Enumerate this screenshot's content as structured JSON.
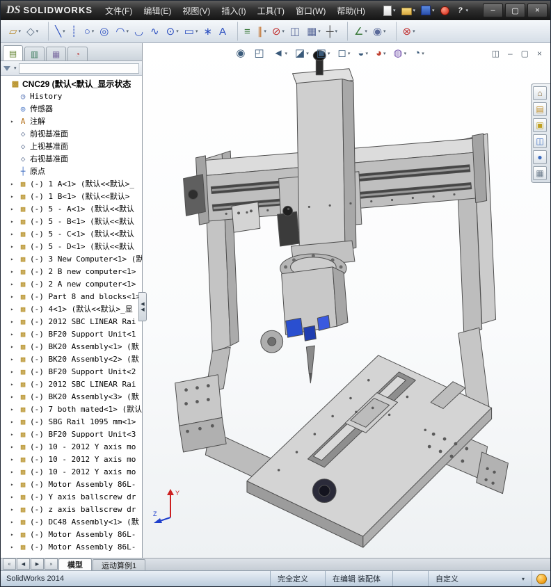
{
  "titlebar": {
    "logo": {
      "ds": "DS",
      "text": "SOLIDWORKS"
    },
    "menu": [
      "文件(F)",
      "编辑(E)",
      "视图(V)",
      "插入(I)",
      "工具(T)",
      "窗口(W)",
      "帮助(H)"
    ],
    "quick_icons": [
      {
        "name": "new-document-icon",
        "kind": "page",
        "glyph": "",
        "caret": "▾"
      },
      {
        "name": "open-icon",
        "kind": "folder",
        "glyph": "",
        "caret": "▾"
      },
      {
        "name": "save-icon",
        "kind": "floppy",
        "glyph": "",
        "caret": "▾"
      },
      {
        "name": "rebuild-icon",
        "kind": "rebuild",
        "glyph": "",
        "caret": ""
      },
      {
        "name": "help-icon",
        "kind": "help",
        "glyph": "?",
        "caret": "▾"
      }
    ],
    "window_buttons": [
      {
        "name": "minimize-button",
        "glyph": "–"
      },
      {
        "name": "restore-button",
        "glyph": "▢"
      },
      {
        "name": "close-button",
        "glyph": "×"
      }
    ]
  },
  "toolbar": {
    "icons": [
      {
        "name": "sketch-icon",
        "glyph": "▱",
        "color": "#b5872a",
        "caret": "▾",
        "gap": 0
      },
      {
        "name": "smart-dimension-icon",
        "glyph": "◇",
        "color": "#5f7186",
        "caret": "▾",
        "gap": 0
      },
      {
        "name": "line-icon",
        "glyph": "╲",
        "color": "#2b4fc0",
        "caret": "▾",
        "gap": 1
      },
      {
        "name": "centerline-icon",
        "glyph": "┊",
        "color": "#2b4fc0",
        "caret": "",
        "gap": 0
      },
      {
        "name": "circle-icon",
        "glyph": "○",
        "color": "#2b4fc0",
        "caret": "▾",
        "gap": 0
      },
      {
        "name": "perimeter-circle-icon",
        "glyph": "◎",
        "color": "#2b4fc0",
        "caret": "",
        "gap": 0
      },
      {
        "name": "centerpoint-arc-icon",
        "glyph": "◠",
        "color": "#2b4fc0",
        "caret": "▾",
        "gap": 0
      },
      {
        "name": "tangent-arc-icon",
        "glyph": "◡",
        "color": "#2b4fc0",
        "caret": "",
        "gap": 0
      },
      {
        "name": "spline-icon",
        "glyph": "∿",
        "color": "#2b4fc0",
        "caret": "",
        "gap": 0
      },
      {
        "name": "ellipse-icon",
        "glyph": "⊙",
        "color": "#2b4fc0",
        "caret": "▾",
        "gap": 0
      },
      {
        "name": "rectangle-icon",
        "glyph": "▭",
        "color": "#2b4fc0",
        "caret": "▾",
        "gap": 0
      },
      {
        "name": "point-icon",
        "glyph": "∗",
        "color": "#2b4fc0",
        "caret": "",
        "gap": 0
      },
      {
        "name": "text-icon",
        "glyph": "A",
        "color": "#2b4fc0",
        "caret": "",
        "gap": 0
      },
      {
        "name": "convert-entities-icon",
        "glyph": "≡",
        "color": "#3a7a3a",
        "caret": "",
        "gap": 1
      },
      {
        "name": "offset-entities-icon",
        "glyph": "∥",
        "color": "#c06a20",
        "caret": "▾",
        "gap": 0
      },
      {
        "name": "trim-entities-icon",
        "glyph": "⊘",
        "color": "#c03030",
        "caret": "▾",
        "gap": 0
      },
      {
        "name": "mirror-entities-icon",
        "glyph": "◫",
        "color": "#5a6a9a",
        "caret": "",
        "gap": 0
      },
      {
        "name": "linear-pattern-icon",
        "glyph": "▦",
        "color": "#5a6a9a",
        "caret": "▾",
        "gap": 0
      },
      {
        "name": "move-entities-icon",
        "glyph": "┼",
        "color": "#4a4a4a",
        "caret": "▾",
        "gap": 0
      },
      {
        "name": "display-relations-icon",
        "glyph": "∠",
        "color": "#3a7a3a",
        "caret": "▾",
        "gap": 1
      },
      {
        "name": "quick-snaps-icon",
        "glyph": "◉",
        "color": "#5a6a9a",
        "caret": "▾",
        "gap": 0
      },
      {
        "name": "select-filter-icon",
        "glyph": "⊗",
        "color": "#c03030",
        "caret": "▾",
        "gap": 1
      }
    ]
  },
  "panel": {
    "tabs": [
      {
        "name": "featuremanager-tab",
        "glyph": "▤",
        "color": "#6a8a3a",
        "active": 1
      },
      {
        "name": "propertymanager-tab",
        "glyph": "▥",
        "color": "#3a7a5a",
        "active": 0
      },
      {
        "name": "configurationmanager-tab",
        "glyph": "▦",
        "color": "#7a6aa0",
        "active": 0
      },
      {
        "name": "dimxpert-tab",
        "glyph": "◔",
        "color": "#c05050",
        "active": 0
      }
    ],
    "chevron": "»",
    "filter_caret": "▾",
    "collapse_glyph": "◀"
  },
  "tree": {
    "root": {
      "glyph": "▩",
      "text": "CNC29 (默认<默认_显示状态"
    },
    "component_arrow": "▸",
    "component_glyph": "▩",
    "folders": [
      {
        "arrow": "",
        "glyph": "◷",
        "color": "#4a6ab0",
        "text": "History"
      },
      {
        "arrow": "",
        "glyph": "◎",
        "color": "#3a6ac0",
        "text": "传感器"
      },
      {
        "arrow": "▸",
        "glyph": "A",
        "color": "#b06a10",
        "text": "注解"
      },
      {
        "arrow": "",
        "glyph": "◇",
        "color": "#6a7a9a",
        "text": "前视基准面"
      },
      {
        "arrow": "",
        "glyph": "◇",
        "color": "#6a7a9a",
        "text": "上视基准面"
      },
      {
        "arrow": "",
        "glyph": "◇",
        "color": "#6a7a9a",
        "text": "右视基准面"
      },
      {
        "arrow": "",
        "glyph": "┼",
        "color": "#3a6ac0",
        "text": "原点"
      }
    ],
    "components": [
      "(-) 1 A<1> (默认<<默认>_",
      "(-) 1 B<1> (默认<<默认>",
      "(-) 5 - A<1> (默认<<默认",
      "(-) 5 - B<1> (默认<<默认",
      "(-) 5 - C<1> (默认<<默认",
      "(-) 5 - D<1> (默认<<默认",
      "(-) 3 New Computer<1> (默",
      "(-) 2 B new computer<1> (",
      "(-) 2 A new computer<1> (",
      "(-) Part 8 and blocks<1> (",
      "(-) 4<1> (默认<<默认>_显",
      "(-) 2012 SBC LINEAR Rai",
      "(-) BF20 Support Unit<1",
      "(-) BK20 Assembly<1> (默",
      "(-) BK20 Assembly<2> (默",
      "(-) BF20 Support Unit<2",
      "(-) 2012 SBC LINEAR Rai",
      "(-) BK20 Assembly<3> (默",
      "(-) 7 both mated<1> (默认",
      "(-) SBG Rail 1095 mm<1>",
      "(-) BF20 Support Unit<3",
      "(-) 10 - 2012 Y axis mo",
      "(-) 10 - 2012 Y axis mo",
      "(-) 10 - 2012 Y axis mo",
      "(-) Motor Assembly 86L-",
      "(-) Y axis ballscrew dr",
      "(-) z axis ballscrew dr",
      "(-) DC48 Assembly<1> (默",
      "(-) Motor Assembly 86L-",
      "(-) Motor Assembly 86L-"
    ]
  },
  "hud": {
    "icons": [
      {
        "name": "zoom-to-fit-icon",
        "glyph": "◉",
        "color": "#3a5a7a",
        "caret": ""
      },
      {
        "name": "zoom-to-area-icon",
        "glyph": "◰",
        "color": "#3a5a7a",
        "caret": ""
      },
      {
        "name": "previous-view-icon",
        "glyph": "◄",
        "color": "#3a5a7a",
        "caret": "▾"
      },
      {
        "name": "section-view-icon",
        "glyph": "◪",
        "color": "#3a5a7a",
        "caret": "▾"
      },
      {
        "name": "view-orientation-icon",
        "glyph": "▣",
        "color": "#3a5a7a",
        "caret": "▾"
      },
      {
        "name": "display-style-icon",
        "glyph": "◻",
        "color": "#3a5a7a",
        "caret": "▾"
      },
      {
        "name": "hide-show-items-icon",
        "glyph": "◒",
        "color": "#3a5a7a",
        "caret": "▾"
      },
      {
        "name": "edit-appearance-icon",
        "glyph": "◕",
        "color": "#c04030",
        "caret": "▾"
      },
      {
        "name": "apply-scene-icon",
        "glyph": "◍",
        "color": "#7a5ab0",
        "caret": "▾"
      },
      {
        "name": "view-settings-icon",
        "glyph": "◔",
        "color": "#3a5a7a",
        "caret": "▾"
      }
    ],
    "pane_controls": [
      {
        "name": "pane-split-icon",
        "glyph": "◫"
      },
      {
        "name": "doc-minimize-icon",
        "glyph": "–"
      },
      {
        "name": "doc-restore-icon",
        "glyph": "▢"
      },
      {
        "name": "doc-close-icon",
        "glyph": "×"
      }
    ]
  },
  "taskpane": {
    "icons": [
      {
        "name": "home-icon",
        "glyph": "⌂",
        "color": "#8a6a3a"
      },
      {
        "name": "design-library-icon",
        "glyph": "▤",
        "color": "#c08a20"
      },
      {
        "name": "file-explorer-icon",
        "glyph": "▣",
        "color": "#c0a020"
      },
      {
        "name": "view-palette-icon",
        "glyph": "◫",
        "color": "#3a6ac0"
      },
      {
        "name": "appearances-icon",
        "glyph": "●",
        "color": "#3a6ac0"
      },
      {
        "name": "custom-properties-icon",
        "glyph": "▦",
        "color": "#6a7a8a"
      }
    ]
  },
  "doc_tabs": {
    "nav": [
      {
        "name": "first-tab-button",
        "glyph": "«"
      },
      {
        "name": "prev-tab-button",
        "glyph": "◀"
      },
      {
        "name": "next-tab-button",
        "glyph": "▶"
      },
      {
        "name": "last-tab-button",
        "glyph": "»"
      }
    ],
    "tabs": [
      {
        "label": "模型",
        "active": 1
      },
      {
        "label": "运动算例1",
        "active": 0
      }
    ]
  },
  "statusbar": {
    "left": "SolidWorks 2014",
    "segments": [
      "完全定义",
      "在编辑 装配体",
      "自定义"
    ],
    "custom_caret": "▾"
  },
  "triad": {
    "y_label": "Y",
    "z_label": "Z",
    "y_color": "#cc2020",
    "z_color": "#2040cc"
  }
}
